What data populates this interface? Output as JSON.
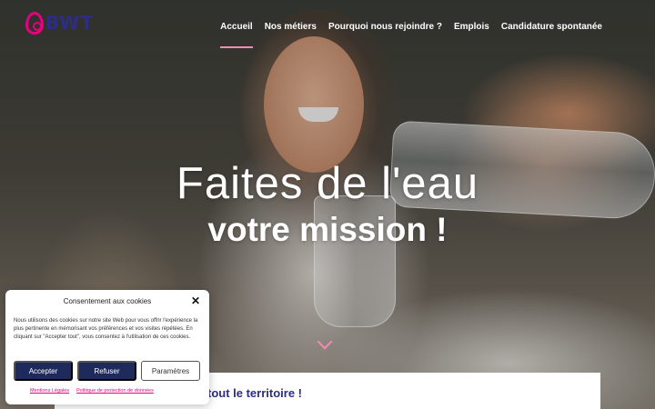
{
  "brand": {
    "logo_text": "BWT",
    "accent": "#e6007e",
    "primary": "#2d2e83"
  },
  "nav": {
    "items": [
      {
        "label": "Accueil",
        "active": true
      },
      {
        "label": "Nos métiers",
        "active": false
      },
      {
        "label": "Pourquoi nous rejoindre ?",
        "active": false
      },
      {
        "label": "Emplois",
        "active": false
      },
      {
        "label": "Candidature spontanée",
        "active": false
      }
    ]
  },
  "hero": {
    "line1": "Faites de l'eau",
    "line2": "votre mission !",
    "scroll_icon": "chevron-down-icon"
  },
  "section": {
    "heading": "tout le territoire !"
  },
  "cookie_banner": {
    "title": "Consentement aux cookies",
    "close_icon": "close-icon",
    "text": "Nous utilisons des cookies sur notre site Web pour vous offrir l'expérience la plus pertinente en mémorisant vos préférences et vos visites répétées. En cliquant sur \"Accepter tout\", vous consentez à l'utilisation de ces cookies.",
    "accept_label": "Accepter",
    "refuse_label": "Refuser",
    "settings_label": "Paramètres",
    "links": [
      "Mentions Légales",
      "Politique de protection de données"
    ]
  }
}
